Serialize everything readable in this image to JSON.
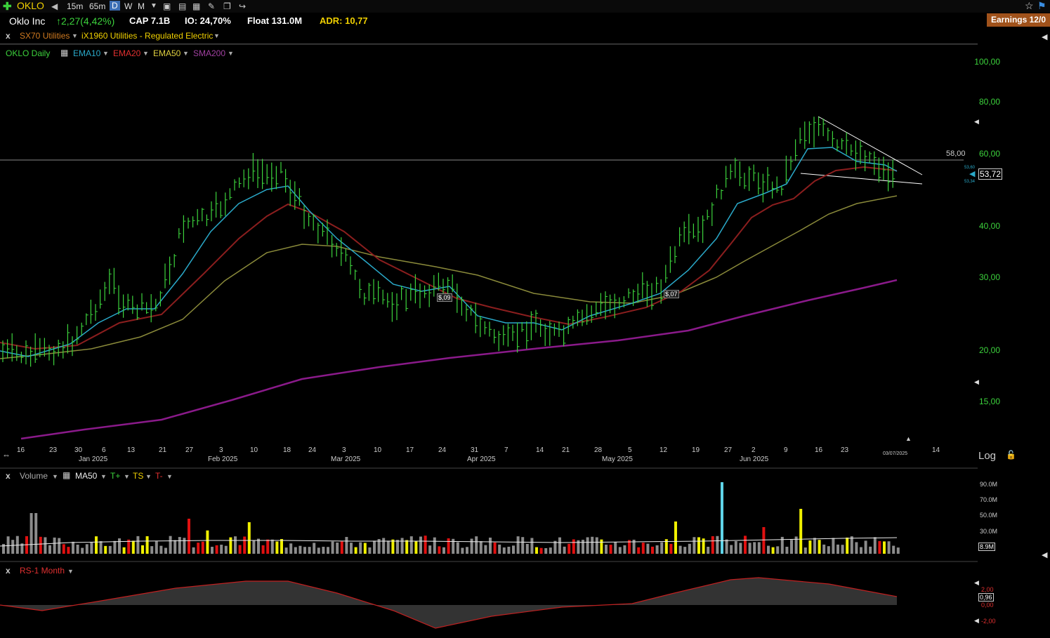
{
  "toolbar": {
    "symbol": "OKLO",
    "interval_15m": "15m",
    "interval_65m": "65m",
    "interval_d": "D",
    "interval_w": "W",
    "interval_m": "M"
  },
  "info": {
    "company": "Oklo Inc",
    "change": "↑2,27(4,42%)",
    "cap": "CAP 7.1B",
    "io": "IO: 24,70%",
    "float": "Float 131.0M",
    "adr": "ADR: 10,77",
    "earnings": "Earnings 12/0"
  },
  "sector": {
    "close": "x",
    "sector": "SX70 Utilities",
    "industry": "iX1960 Utilities - Regulated Electric"
  },
  "price_legend": {
    "symbol_daily": "OKLO Daily",
    "ema10": "EMA10",
    "ema20": "EMA20",
    "ema50": "EMA50",
    "sma200": "SMA200"
  },
  "price_axis": {
    "labels": [
      "100,00",
      "80,00",
      "60,00",
      "40,00",
      "30,00",
      "20,00",
      "15,00"
    ],
    "level_line": "58,00",
    "last_price": "53,72",
    "ema_small_top": "53,60",
    "ema_small_bottom": "53,34",
    "log": "Log"
  },
  "chart_markers": {
    "marker1": "$,09",
    "marker2": "$,07"
  },
  "time_axis": {
    "days": [
      "16",
      "23",
      "30",
      "6",
      "13",
      "21",
      "27",
      "3",
      "10",
      "18",
      "24",
      "3",
      "10",
      "17",
      "24",
      "31",
      "7",
      "14",
      "21",
      "28",
      "5",
      "12",
      "19",
      "27",
      "2",
      "9",
      "16",
      "23",
      "14"
    ],
    "months": [
      "Jan 2025",
      "Feb 2025",
      "Mar 2025",
      "Apr 2025",
      "May 2025",
      "Jun 2025"
    ],
    "current_date": "03/07/2025"
  },
  "volume_legend": {
    "close": "x",
    "volume": "Volume",
    "ma50": "MA50",
    "t_plus": "T+",
    "ts": "TS",
    "t_minus": "T-"
  },
  "volume_axis": {
    "labels": [
      "90.0M",
      "70.0M",
      "50.0M",
      "30.0M"
    ],
    "last_volume": "8.9M"
  },
  "rs_legend": {
    "close": "x",
    "name": "RS-1 Month"
  },
  "rs_axis": {
    "labels": [
      "2,00",
      "0,00",
      "-2,00"
    ],
    "last": "0,96"
  },
  "colors": {
    "up_bar": "#3cd23c",
    "ema10": "#2aa9c9",
    "ema20": "#8b1e1e",
    "ema50": "#8a8a3a",
    "sma200": "#8a1a8a",
    "vol_grey": "#8c8c8c",
    "vol_yellow": "#f0f000",
    "vol_red": "#e01010",
    "vol_cyan": "#5fd4e8",
    "rs_line": "#c02020"
  }
}
